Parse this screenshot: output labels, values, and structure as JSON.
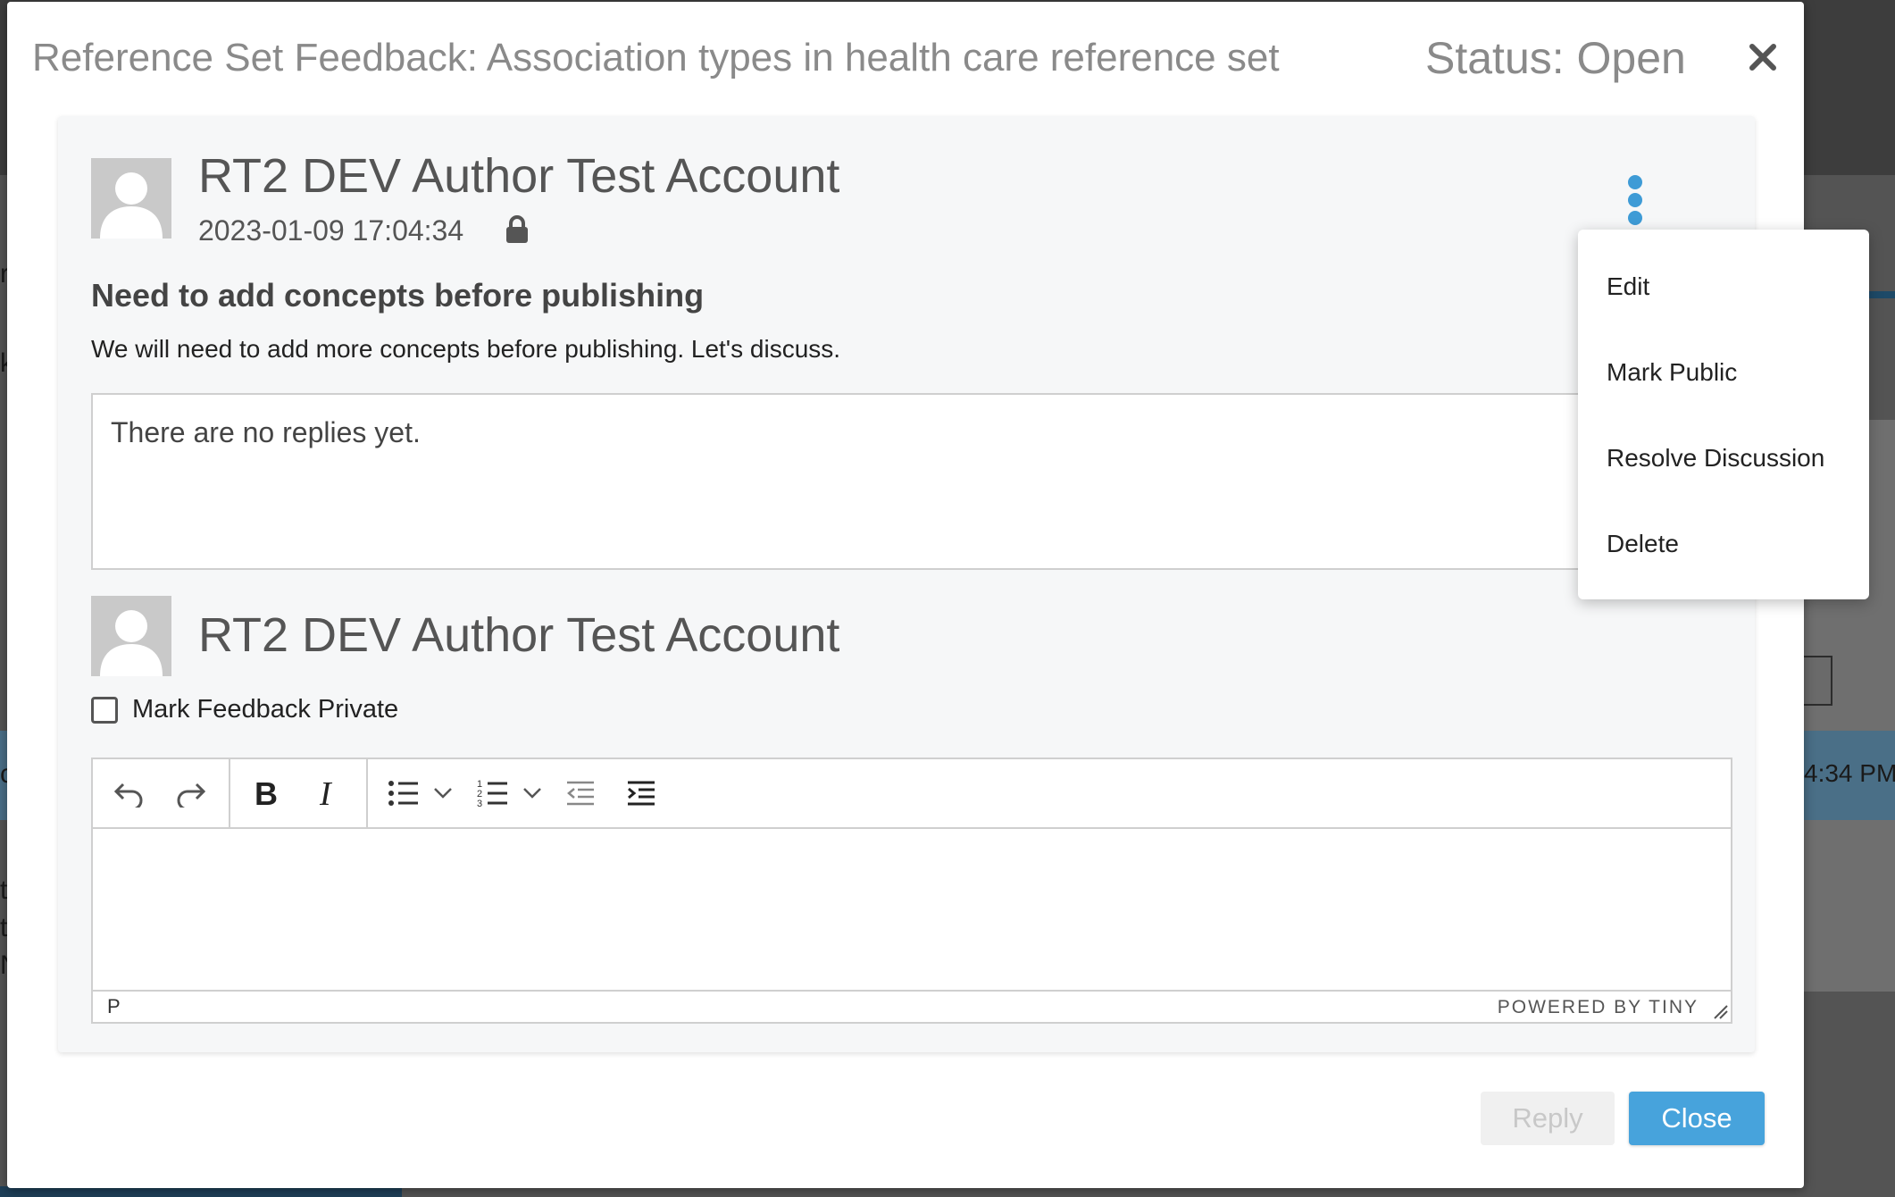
{
  "background": {
    "time_fragment": "4:34 PM",
    "edge_chars": [
      "r",
      "k",
      "c",
      "t",
      "t",
      "N"
    ]
  },
  "modal": {
    "title": "Reference Set Feedback: Association types in health care reference set",
    "status": "Status: Open",
    "close_icon": "close-icon"
  },
  "feedback": {
    "author": "RT2 DEV Author Test Account",
    "timestamp": "2023-01-09 17:04:34",
    "lock_icon": "lock-icon",
    "subject": "Need to add concepts before publishing",
    "body": "We will need to add more concepts before publishing. Let's discuss.",
    "replies_placeholder": "There are no replies yet."
  },
  "reply_form": {
    "author": "RT2 DEV Author Test Account",
    "private_label": "Mark Feedback Private",
    "private_checked": false,
    "editor": {
      "toolbar": [
        "undo-icon",
        "redo-icon",
        "bold-icon",
        "italic-icon",
        "bullet-list-icon",
        "chevron-down-icon",
        "numbered-list-icon",
        "chevron-down-icon",
        "outdent-icon",
        "indent-icon"
      ],
      "path": "P",
      "branding": "POWERED BY TINY"
    }
  },
  "actions": {
    "reply_label": "Reply",
    "close_label": "Close"
  },
  "menu": {
    "items": [
      "Edit",
      "Mark Public",
      "Resolve Discussion",
      "Delete"
    ]
  },
  "colors": {
    "accent": "#47a3dc",
    "kebab": "#3e9bd6",
    "card_bg": "#f6f7f8"
  }
}
